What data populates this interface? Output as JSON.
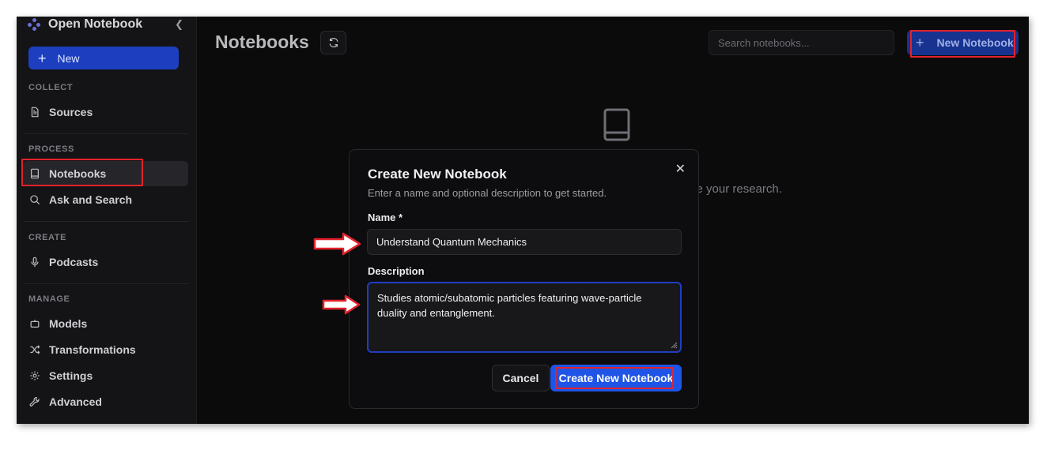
{
  "app": {
    "title": "Open Notebook",
    "collapse_icon": "chevron-left-icon",
    "new_label": "New"
  },
  "sidebar": {
    "sections": [
      {
        "label": "COLLECT",
        "items": [
          {
            "label": "Sources",
            "icon": "file-text-icon"
          }
        ]
      },
      {
        "label": "PROCESS",
        "items": [
          {
            "label": "Notebooks",
            "icon": "book-icon",
            "active": true
          },
          {
            "label": "Ask and Search",
            "icon": "search-icon"
          }
        ]
      },
      {
        "label": "CREATE",
        "items": [
          {
            "label": "Podcasts",
            "icon": "mic-icon"
          }
        ]
      },
      {
        "label": "MANAGE",
        "items": [
          {
            "label": "Models",
            "icon": "bot-icon"
          },
          {
            "label": "Transformations",
            "icon": "shuffle-icon"
          },
          {
            "label": "Settings",
            "icon": "gear-icon"
          },
          {
            "label": "Advanced",
            "icon": "wrench-icon"
          }
        ]
      }
    ]
  },
  "header": {
    "title": "Notebooks",
    "refresh_icon": "refresh-icon",
    "search_placeholder": "Search notebooks...",
    "new_notebook_label": "New Notebook"
  },
  "empty_state": {
    "icon": "book-icon",
    "text_visible": "ze your research."
  },
  "modal": {
    "title": "Create New Notebook",
    "subtitle": "Enter a name and optional description to get started.",
    "name_label": "Name *",
    "name_value": "Understand Quantum Mechanics",
    "description_label": "Description",
    "description_value": "Studies atomic/subatomic particles featuring wave-particle duality and entanglement.",
    "cancel_label": "Cancel",
    "create_label": "Create New Notebook",
    "close_icon": "close-icon"
  },
  "colors": {
    "highlight": "#e3222b",
    "primary": "#1f55e6",
    "sidebar_new": "#1d3fbf",
    "background": "#0b0b0c"
  }
}
